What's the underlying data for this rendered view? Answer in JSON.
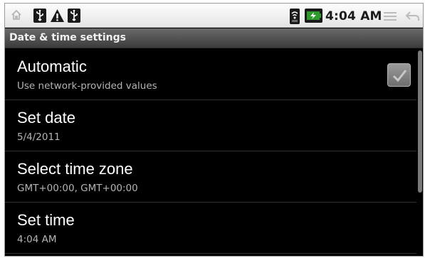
{
  "status_bar": {
    "time": "4:04 AM",
    "icons": [
      "home-icon",
      "usb-icon",
      "warning-icon",
      "usb-icon",
      "wifi-signal-icon",
      "battery-charging-icon",
      "menu-icon",
      "back-icon"
    ]
  },
  "title_bar": {
    "title": "Date & time settings"
  },
  "settings": [
    {
      "title": "Automatic",
      "summary": "Use network-provided values",
      "checked": true
    },
    {
      "title": "Set date",
      "summary": "5/4/2011"
    },
    {
      "title": "Select time zone",
      "summary": "GMT+00:00, GMT+00:00"
    },
    {
      "title": "Set time",
      "summary": "4:04 AM"
    }
  ],
  "colors": {
    "background": "#000000",
    "title_text": "#ffffff",
    "summary_text": "#b4b4b4",
    "status_bar": "#eeeeee",
    "battery_accent": "#2e9a2e"
  }
}
